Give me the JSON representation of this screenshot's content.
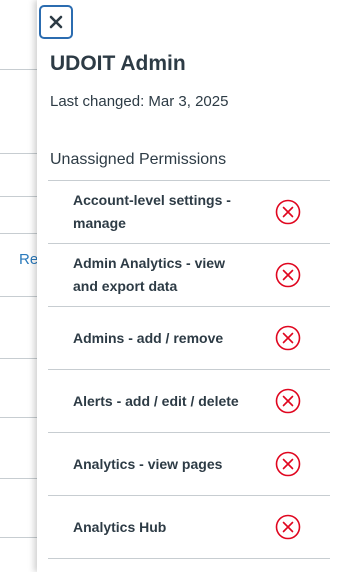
{
  "background": {
    "partial_link_text": "Re"
  },
  "tray": {
    "title": "UDOIT Admin",
    "last_changed": "Last changed: Mar 3, 2025",
    "close_icon": "close-icon",
    "section_heading": "Unassigned Permissions",
    "status_color": "#e0061f",
    "permissions": [
      {
        "label": "Account-level settings - manage",
        "status_icon": "x-circle-icon"
      },
      {
        "label": "Admin Analytics - view and export data",
        "status_icon": "x-circle-icon"
      },
      {
        "label": "Admins - add / remove",
        "status_icon": "x-circle-icon"
      },
      {
        "label": "Alerts - add / edit / delete",
        "status_icon": "x-circle-icon"
      },
      {
        "label": "Analytics - view pages",
        "status_icon": "x-circle-icon"
      },
      {
        "label": "Analytics Hub",
        "status_icon": "x-circle-icon"
      }
    ]
  }
}
